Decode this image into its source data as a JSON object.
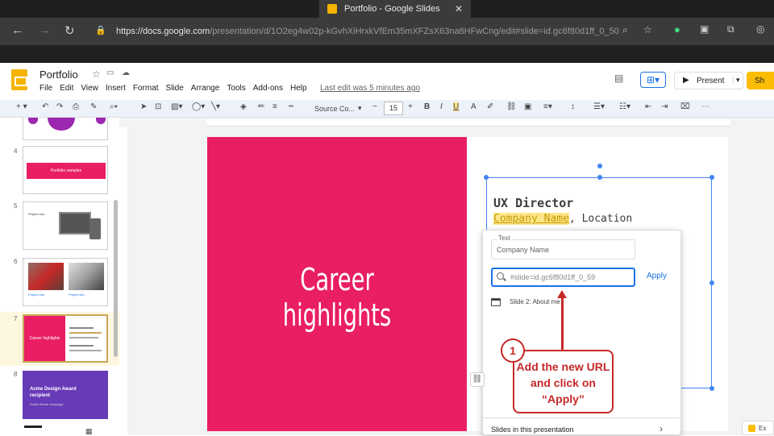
{
  "browser": {
    "tab_title": "Portfolio - Google Slides",
    "url_main": "https://docs.google.com",
    "url_rest": "/presentation/d/1O2eg4w02p-kGvhXiHrxkVfEm35mXFZsX63na8HFwCng/edit#slide=id.gc6f80d1ff_0_50"
  },
  "doc": {
    "title": "Portfolio",
    "menu": [
      "File",
      "Edit",
      "View",
      "Insert",
      "Format",
      "Slide",
      "Arrange",
      "Tools",
      "Add-ons",
      "Help"
    ],
    "last_edit": "Last edit was 5 minutes ago",
    "present_label": "Present",
    "share_label": "Sh"
  },
  "toolbar": {
    "font": "Source Co...",
    "font_size": "15"
  },
  "filmstrip": {
    "numbers": [
      "4",
      "5",
      "6",
      "7",
      "8"
    ],
    "slide4_text": "Portfolio samples",
    "slide5_text": "Project one",
    "slide6_left": "Project one",
    "slide6_right": "Project two",
    "slide7_text": "Career highlights",
    "slide8_text": "Acme Design Award recipient",
    "slide8_sub": "Studio Name campaign"
  },
  "slide": {
    "title": "Career highlights",
    "role": "UX Director",
    "company": "Company Name",
    "location": ", Location"
  },
  "link_popup": {
    "text_label": "Text",
    "text_value": "Company Name",
    "url_value": "#slide=id.gc6f80d1ff_0_59",
    "apply_label": "Apply",
    "suggestion": "Slide 2: About me",
    "slides_in_presentation": "Slides in this presentation"
  },
  "annotation": {
    "step_number": "1",
    "text": "Add the new URL and click on “Apply”"
  },
  "explore_label": "Ex",
  "colors": {
    "accent_pink": "#e91e63",
    "annotation_red": "#c62828",
    "link_blue": "#1a73e8",
    "share_yellow": "#fbbc04"
  }
}
